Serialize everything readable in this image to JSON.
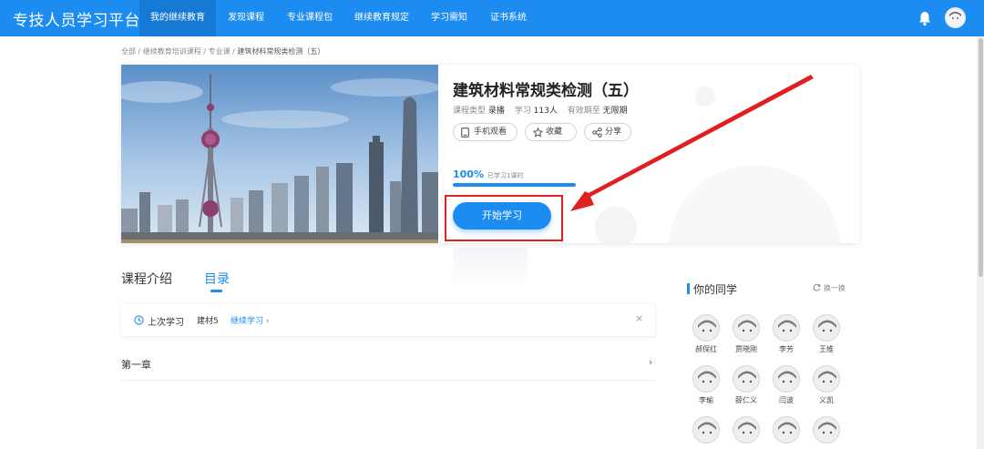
{
  "app": {
    "title": "专技人员学习平台"
  },
  "nav": {
    "items": [
      {
        "label": "我的继续教育",
        "active": true
      },
      {
        "label": "发现课程"
      },
      {
        "label": "专业课程包"
      },
      {
        "label": "继续教育规定"
      },
      {
        "label": "学习需知"
      },
      {
        "label": "证书系统"
      }
    ],
    "icons": [
      "bell-icon",
      "avatar"
    ]
  },
  "breadcrumb": {
    "items": [
      "全部",
      "继续教育培训课程",
      "专业课",
      "建筑材料常规类检测（五）"
    ],
    "separator": " / "
  },
  "course": {
    "title": "建筑材料常规类检测（五）",
    "type_label": "课程类型",
    "type_value": "录播",
    "study_label": "学习",
    "study_value": "113人",
    "valid_label": "有效期至",
    "valid_value": "无限期",
    "actions": {
      "mobile": "手机观看",
      "favorite": "收藏",
      "share": "分享"
    },
    "progress_text": "100%",
    "progress_fraction": 1.0,
    "progress_note": "已学习1课时",
    "start_button": "开始学习"
  },
  "tabs": {
    "intro": "课程介绍",
    "catalog": "目录",
    "active": "catalog"
  },
  "last_study": {
    "label": "上次学习",
    "item": "建材5",
    "link": "继续学习"
  },
  "chapters": [
    {
      "label": "第一章"
    }
  ],
  "classmates": {
    "title": "你的同学",
    "switch_label": "换一换",
    "people": [
      "郝保红",
      "贾晓刚",
      "李芳",
      "王维",
      "李瑜",
      "薛仁义",
      "闫波",
      "义凯"
    ]
  },
  "colors": {
    "primary": "#1d8cf0",
    "annotation_red": "#e02020"
  }
}
